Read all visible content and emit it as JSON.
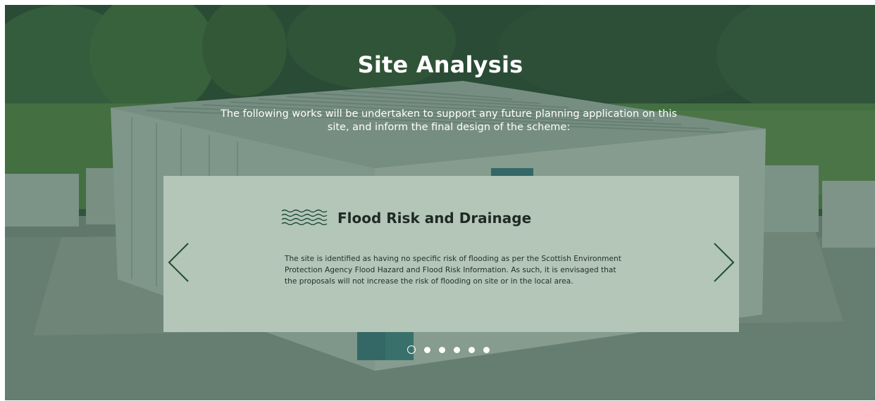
{
  "section": {
    "title": "Site Analysis",
    "intro": "The following works will be undertaken to support any future planning application on this site, and inform the final design of the scheme:"
  },
  "slide": {
    "icon": "water-waves-icon",
    "title": "Flood Risk and Drainage",
    "body": "The site is identified as having no specific risk of flooding as per the Scottish Environment Protection Agency Flood Hazard and Flood Risk Information. As such, it is envisaged that the proposals will not increase the risk of flooding on site or in the local area."
  },
  "carousel": {
    "prev_icon": "chevron-left-icon",
    "next_icon": "chevron-right-icon",
    "total_slides": 6,
    "active_slide": 1
  },
  "colors": {
    "overlay": "#264e38",
    "card_background": "#b3c6b8",
    "arrow": "#1f4a34",
    "text_light": "#ffffff",
    "text_dark": "#1f2a24"
  }
}
